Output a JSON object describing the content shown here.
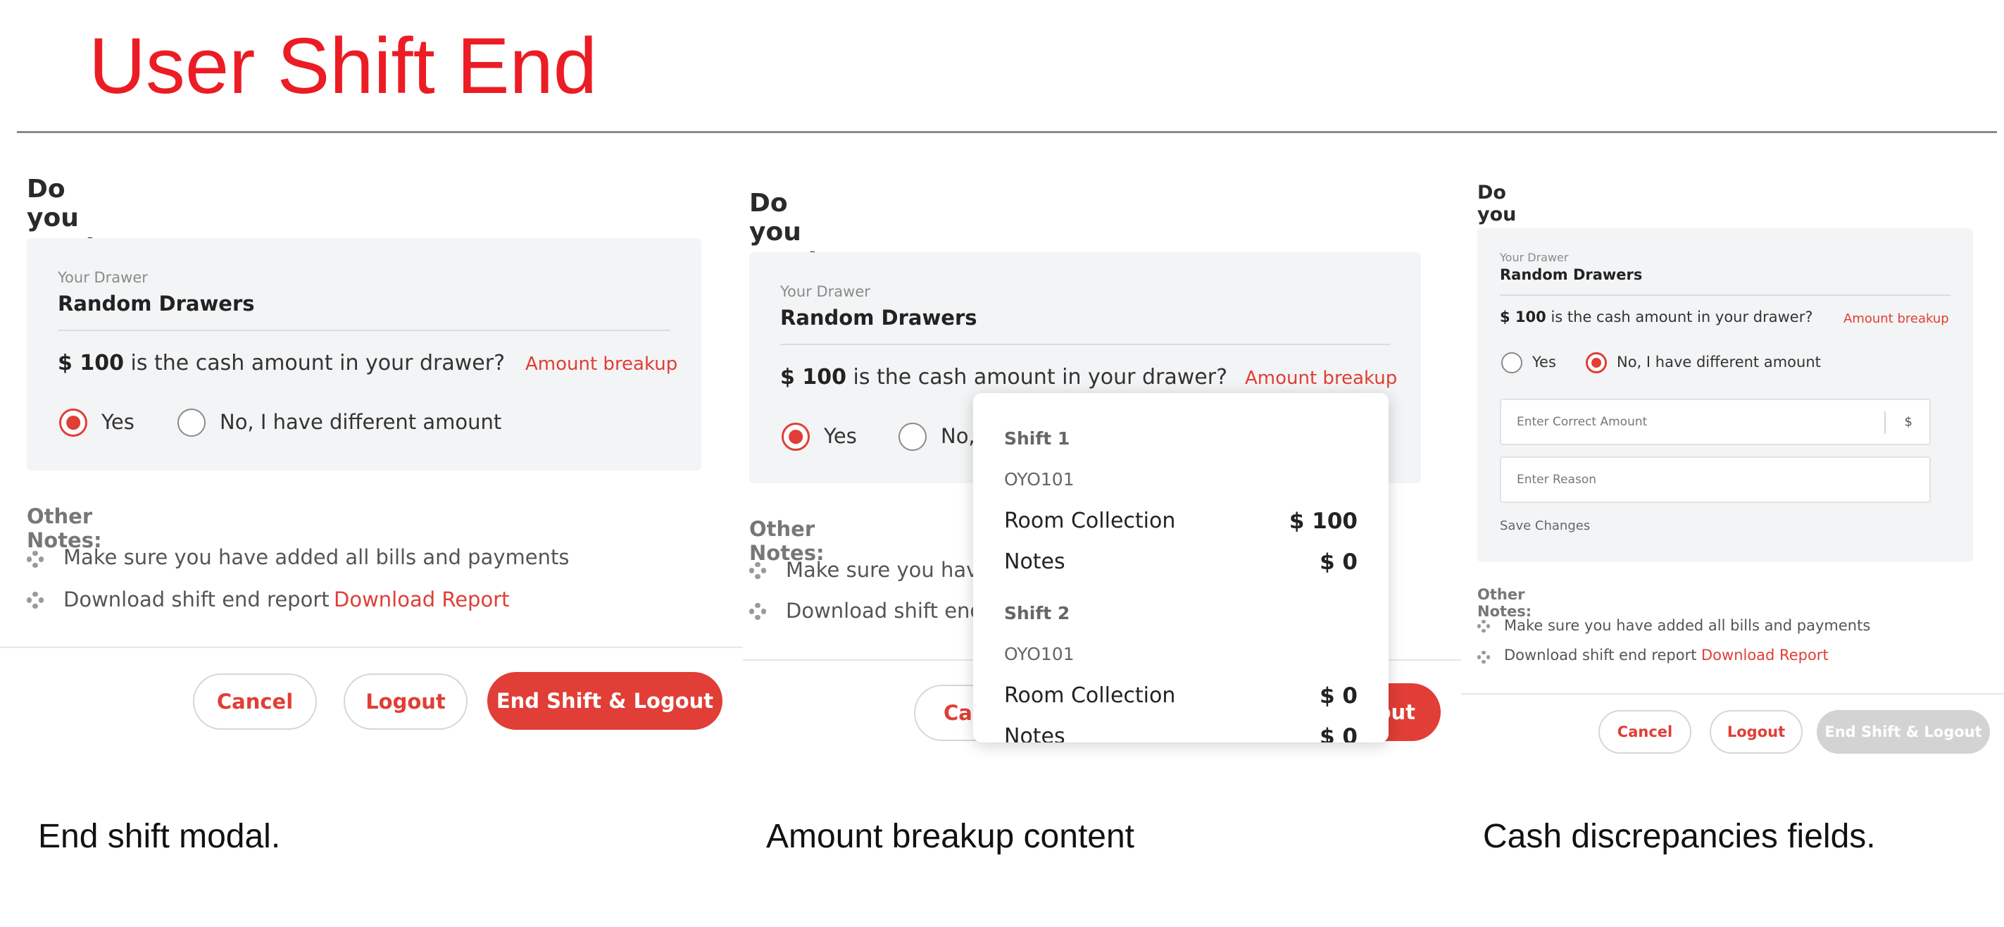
{
  "page": {
    "title": "User Shift End"
  },
  "common": {
    "question": "Do you want to end your shift?",
    "drawer_label": "Your Drawer",
    "drawer_name": "Random Drawers",
    "cash_amount": "$ 100",
    "cash_text": "is the cash amount in your drawer?",
    "amount_breakup": "Amount breakup",
    "yes": "Yes",
    "no_different": "No, I have different amount",
    "other_notes": "Other Notes:",
    "note_bills": "Make sure you have added all bills and payments",
    "note_report": "Download shift end report",
    "download_report": "Download Report",
    "cancel": "Cancel",
    "logout": "Logout",
    "end_shift_logout": "End Shift & Logout"
  },
  "panel2": {
    "no_truncated": "No,",
    "note_bills_truncated": "Make sure you have",
    "note_report_truncated": "Download shift end",
    "cancel_truncated": "Car",
    "end_truncated": "out"
  },
  "breakup": {
    "shifts": [
      {
        "title": "Shift 1",
        "code": "OYO101",
        "rows": [
          {
            "label": "Room Collection",
            "value": "$ 100"
          },
          {
            "label": "Notes",
            "value": "$ 0"
          }
        ]
      },
      {
        "title": "Shift 2",
        "code": "OYO101",
        "rows": [
          {
            "label": "Room Collection",
            "value": "$ 0"
          },
          {
            "label": "Notes",
            "value": "$ 0"
          }
        ]
      }
    ]
  },
  "panel3": {
    "correct_amount_placeholder": "Enter Correct Amount",
    "currency": "$",
    "reason_placeholder": "Enter Reason",
    "save_changes": "Save Changes"
  },
  "captions": {
    "c1": "End shift modal.",
    "c2": "Amount breakup content",
    "c3": "Cash discrepancies fields."
  },
  "colors": {
    "accent": "#e03e36",
    "title_red": "#ec1c24",
    "box_bg": "#f3f4f5",
    "disabled": "#d3d3d3"
  }
}
